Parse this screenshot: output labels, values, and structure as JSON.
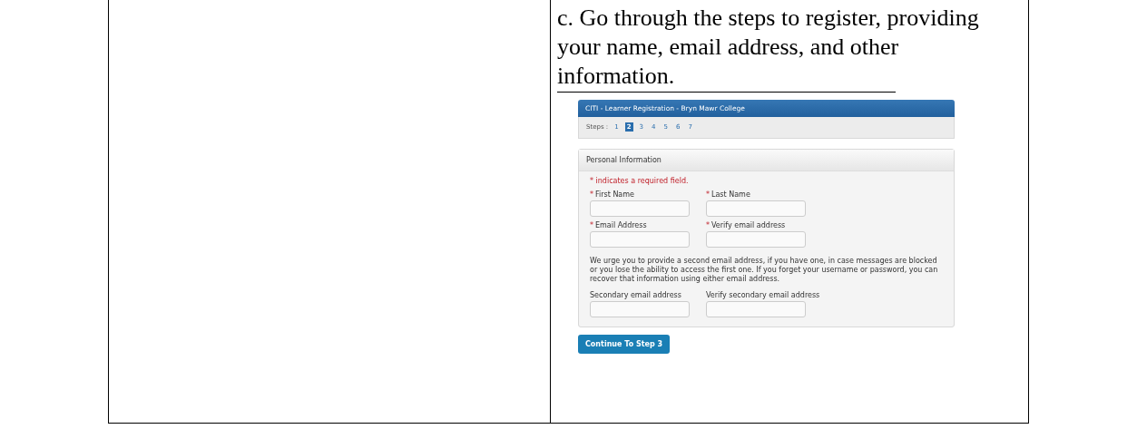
{
  "instruction": "c. Go through the steps to register, providing your name, email address, and other information.",
  "registration": {
    "title": "CITI - Learner Registration - Bryn Mawr College",
    "steps_label": "Steps :",
    "steps": [
      {
        "label": "1",
        "selected": false
      },
      {
        "label": "2",
        "selected": true
      },
      {
        "label": "3",
        "selected": false
      },
      {
        "label": "4",
        "selected": false
      },
      {
        "label": "5",
        "selected": false
      },
      {
        "label": "6",
        "selected": false
      },
      {
        "label": "7",
        "selected": false
      }
    ],
    "section_title": "Personal Information",
    "required_note": "* indicates a required field.",
    "fields": [
      {
        "marker": "*",
        "label": "First Name"
      },
      {
        "marker": "*",
        "label": "Last Name"
      },
      {
        "marker": "*",
        "label": "Email Address"
      },
      {
        "marker": "*",
        "label": "Verify email address"
      }
    ],
    "note": "We urge you to provide a second email address, if you have one, in case messages are blocked or you lose the ability to access the first one. If you forget your username or password, you can recover that information using either email address.",
    "secondary_fields": [
      {
        "label": "Secondary email address"
      },
      {
        "label": "Verify secondary email address"
      }
    ],
    "button": "Continue To Step 3"
  }
}
